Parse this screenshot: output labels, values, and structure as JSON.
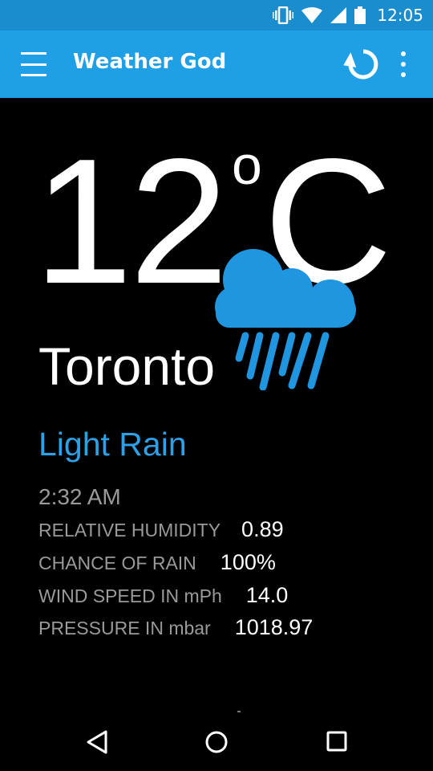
{
  "status_bar": {
    "time": "12:05",
    "icons": [
      "vibrate-icon",
      "wifi-icon",
      "cell-signal-icon",
      "battery-icon"
    ],
    "color": "#1a8dcf"
  },
  "app_bar": {
    "title": "Weather God",
    "color": "#1e9fe6",
    "icons": [
      "menu-icon",
      "refresh-icon",
      "more-vert-icon"
    ]
  },
  "weather": {
    "temperature": "12",
    "degree_symbol": "o",
    "unit": "C",
    "city": "Toronto",
    "condition": "Light Rain",
    "condition_icon": "rain-cloud-icon",
    "time": "2:32 AM",
    "accent_color": "#2ea0e6"
  },
  "details": [
    {
      "label": "RELATIVE HUMIDITY",
      "value": "0.89"
    },
    {
      "label": "CHANCE OF RAIN",
      "value": "100%"
    },
    {
      "label": "WIND SPEED IN mPh",
      "value": "14.0"
    },
    {
      "label": "PRESSURE IN mbar",
      "value": "1018.97"
    }
  ],
  "nav_bar": {
    "icons": [
      "back-icon",
      "home-icon",
      "recents-icon"
    ]
  }
}
